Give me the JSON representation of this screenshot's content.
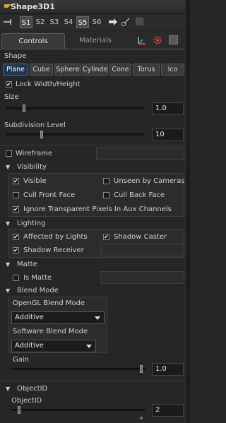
{
  "window": {
    "title": "Shape3D1"
  },
  "slots": [
    "S1",
    "S2",
    "S3",
    "S4",
    "S5",
    "S6"
  ],
  "tabs": {
    "controls": "Controls",
    "materials": "Materials"
  },
  "shape": {
    "label": "Shape",
    "options": [
      "Plane",
      "Cube",
      "Sphere",
      "Cylinder",
      "Cone",
      "Torus",
      "Ico"
    ],
    "selected": "Plane"
  },
  "lock_width_height": {
    "label": "Lock Width/Height",
    "checked": true
  },
  "size": {
    "label": "Size",
    "value": "1.0"
  },
  "subdivision": {
    "label": "Subdivision Level",
    "value": "10"
  },
  "wireframe": {
    "label": "Wireframe",
    "checked": false
  },
  "visibility": {
    "header": "Visibility",
    "visible": {
      "label": "Visible",
      "checked": true
    },
    "unseen_by_cameras": {
      "label": "Unseen by Cameras",
      "checked": false
    },
    "cull_front_face": {
      "label": "Cull Front Face",
      "checked": false
    },
    "cull_back_face": {
      "label": "Cull Back Face",
      "checked": false
    },
    "ignore_transparent": {
      "label": "Ignore Transparent Pixels In Aux Channels",
      "checked": true
    }
  },
  "lighting": {
    "header": "Lighting",
    "affected_by_lights": {
      "label": "Affected by Lights",
      "checked": true
    },
    "shadow_caster": {
      "label": "Shadow Caster",
      "checked": true
    },
    "shadow_receiver": {
      "label": "Shadow Receiver",
      "checked": true
    }
  },
  "matte": {
    "header": "Matte",
    "is_matte": {
      "label": "Is Matte",
      "checked": false
    }
  },
  "blend": {
    "header": "Blend Mode",
    "opengl_label": "OpenGL Blend Mode",
    "opengl_value": "Additive",
    "software_label": "Software Blend Mode",
    "software_value": "Additive",
    "gain_label": "Gain",
    "gain_value": "1.0"
  },
  "objectid": {
    "header": "ObjectID",
    "label": "ObjectID",
    "value": "2"
  },
  "colors": {
    "accent_active": "#1f3550",
    "panel_bg": "#262626",
    "title_arrow": "#e8a020"
  }
}
